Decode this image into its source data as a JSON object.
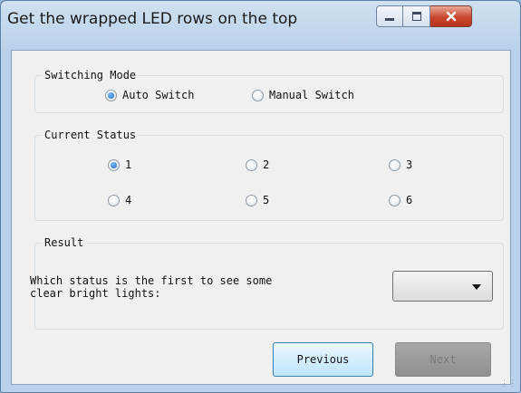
{
  "window": {
    "title": "Get the wrapped LED rows on the top"
  },
  "switching_mode": {
    "legend": "Switching Mode",
    "options": [
      {
        "label": "Auto Switch",
        "selected": true
      },
      {
        "label": "Manual Switch",
        "selected": false
      }
    ]
  },
  "current_status": {
    "legend": "Current Status",
    "options": [
      {
        "label": "1",
        "selected": true
      },
      {
        "label": "2",
        "selected": false
      },
      {
        "label": "3",
        "selected": false
      },
      {
        "label": "4",
        "selected": false
      },
      {
        "label": "5",
        "selected": false
      },
      {
        "label": "6",
        "selected": false
      }
    ]
  },
  "result": {
    "legend": "Result",
    "question_line1": "Which status is the first to see some",
    "question_line2": "clear bright lights:",
    "selected_value": ""
  },
  "buttons": {
    "previous": "Previous",
    "next": "Next"
  },
  "colors": {
    "accent": "#1a5fb0",
    "close": "#c9462f"
  }
}
